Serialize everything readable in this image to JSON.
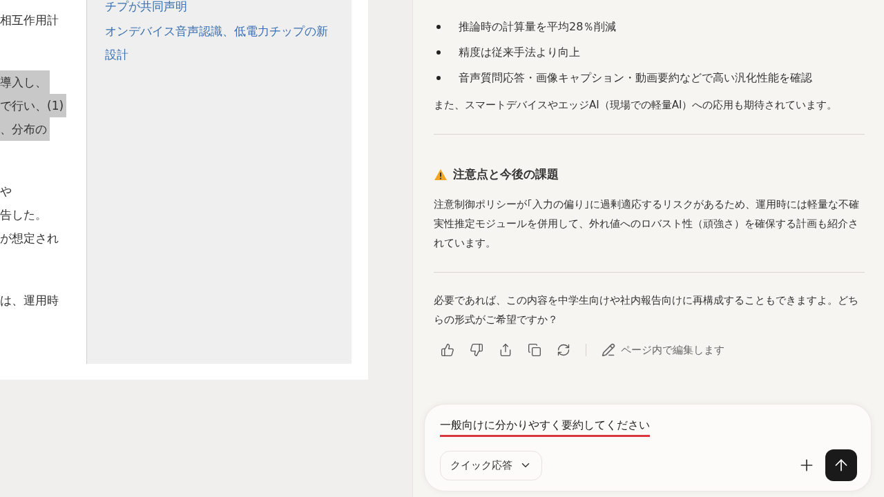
{
  "article": {
    "paragraphs": [
      {
        "lines": [
          {
            "text": "相互作用計",
            "highlighted": false
          }
        ]
      },
      {
        "lines": [
          {
            "text": "導入し、",
            "highlighted": true
          },
          {
            "text": "で行い、(1)",
            "highlighted": true
          },
          {
            "text": "、分布の",
            "highlighted": true
          }
        ]
      },
      {
        "lines": [
          {
            "text": "や",
            "highlighted": false
          },
          {
            "text": "告した。",
            "highlighted": false
          },
          {
            "text": "が想定され",
            "highlighted": false
          }
        ]
      },
      {
        "lines": [
          {
            "text": "は、運用時",
            "highlighted": false
          }
        ]
      }
    ]
  },
  "sidebar": {
    "links": [
      "チプが共同声明",
      "オンデバイス音声認識、低電力チップの新設計"
    ]
  },
  "chat": {
    "bullets": [
      "推論時の計算量を平均28％削減",
      "精度は従来手法より向上",
      "音声質問応答・画像キャプション・動画要約などで高い汎化性能を確認"
    ],
    "summary": "また、スマートデバイスやエッジAI（現場での軽量AI）への応用も期待されています。",
    "section": {
      "heading": "注意点と今後の課題",
      "body": "注意制御ポリシーが｢入力の偏り｣に過剰適応するリスクがあるため、運用時には軽量な不確実性推定モジュールを併用して、外れ値へのロバスト性（頑強さ）を確保する計画も紹介されています。"
    },
    "closing": "必要であれば、この内容を中学生向けや社内報告向けに再構成することもできますよ。どちらの形式がご希望ですか？",
    "actions": [
      {
        "kind": "like"
      },
      {
        "kind": "dislike"
      },
      {
        "kind": "share"
      },
      {
        "kind": "copy"
      },
      {
        "kind": "regenerate"
      },
      {
        "kind": "edit",
        "label": "ページ内で編集します"
      }
    ]
  },
  "composer": {
    "value": "一般向けに分かりやすく要約してください",
    "spellcheck_error": true,
    "mode": "クイック応答"
  }
}
